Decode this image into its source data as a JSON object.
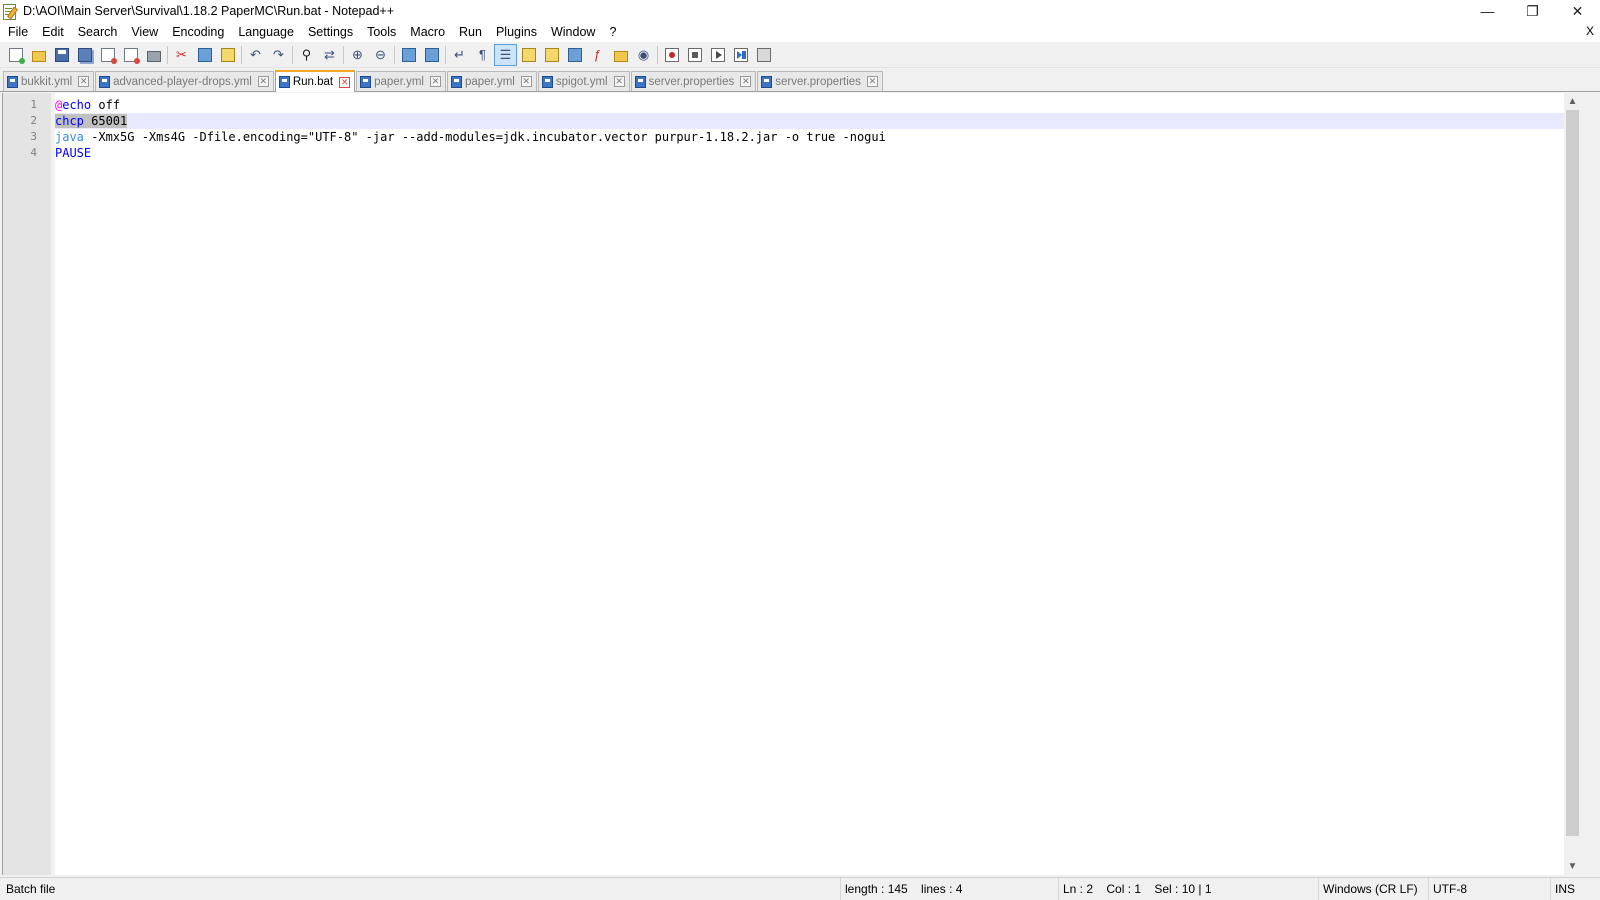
{
  "window": {
    "title": "D:\\AOI\\Main Server\\Survival\\1.18.2 PaperMC\\Run.bat - Notepad++",
    "controls": {
      "minimize": "—",
      "maximize": "❐",
      "close": "✕"
    }
  },
  "menu": {
    "items": [
      "File",
      "Edit",
      "Search",
      "View",
      "Encoding",
      "Language",
      "Settings",
      "Tools",
      "Macro",
      "Run",
      "Plugins",
      "Window",
      "?"
    ],
    "close_label": "X"
  },
  "toolbar": {
    "buttons": [
      "new-file-icon",
      "open-file-icon",
      "save-icon",
      "save-all-icon",
      "close-icon",
      "close-all-icon",
      "print-icon",
      "cut-icon",
      "copy-icon",
      "paste-icon",
      "undo-icon",
      "redo-icon",
      "find-icon",
      "replace-icon",
      "zoom-in-icon",
      "zoom-out-icon",
      "sync-vertical-icon",
      "sync-horizontal-icon",
      "word-wrap-icon",
      "show-all-characters-icon",
      "indent-guide-icon",
      "user-defined-language-icon",
      "document-map-icon",
      "document-list-icon",
      "function-list-icon",
      "folder-as-workspace-icon",
      "monitoring-icon",
      "start-recording-icon",
      "stop-recording-icon",
      "playback-icon",
      "run-macro-multiple-icon",
      "save-macro-icon"
    ],
    "active_button": "indent-guide-icon"
  },
  "tabs": [
    {
      "label": "bukkit.yml",
      "active": false
    },
    {
      "label": "advanced-player-drops.yml",
      "active": false
    },
    {
      "label": "Run.bat",
      "active": true
    },
    {
      "label": "paper.yml",
      "active": false
    },
    {
      "label": "paper.yml",
      "active": false
    },
    {
      "label": "spigot.yml",
      "active": false
    },
    {
      "label": "server.properties",
      "active": false
    },
    {
      "label": "server.properties",
      "active": false
    }
  ],
  "editor": {
    "current_line": 2,
    "lines": [
      {
        "number": "1",
        "tokens": [
          {
            "text": "@",
            "cls": "tok-at"
          },
          {
            "text": "echo",
            "cls": "tok-kw"
          },
          {
            "text": " off",
            "cls": "tok-plain"
          }
        ]
      },
      {
        "number": "2",
        "tokens": [
          {
            "text": "chcp",
            "cls": "tok-kw sel"
          },
          {
            "text": " 65001",
            "cls": "tok-plain sel"
          }
        ]
      },
      {
        "number": "3",
        "tokens": [
          {
            "text": "java",
            "cls": "tok-java"
          },
          {
            "text": " -Xmx5G -Xms4G -Dfile.encoding=\"UTF-8\" -jar --add-modules=jdk.incubator.vector purpur-1.18.2.jar -o true -nogui",
            "cls": "tok-plain"
          }
        ]
      },
      {
        "number": "4",
        "tokens": [
          {
            "text": "PAUSE",
            "cls": "tok-kw"
          }
        ]
      }
    ]
  },
  "status": {
    "file_type": "Batch file",
    "length": "length : 145    lines : 4",
    "position": "Ln : 2    Col : 1    Sel : 10 | 1",
    "eol": "Windows (CR LF)",
    "encoding": "UTF-8",
    "mode": "INS"
  },
  "colors": {
    "active_tab_accent": "#f5a623",
    "current_line_bg": "#e8e8ff",
    "keyword": "#0000ff",
    "at_sign": "#ff00ff"
  }
}
